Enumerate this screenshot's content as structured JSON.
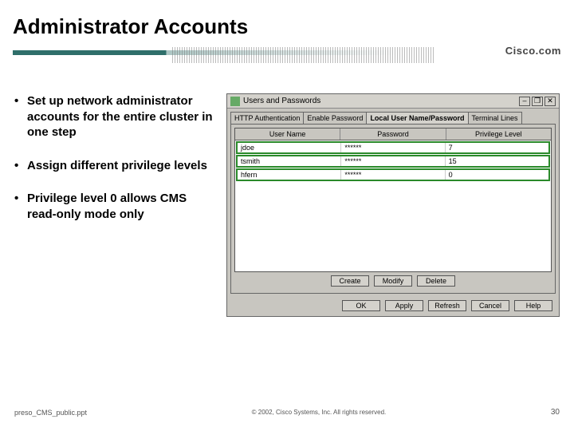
{
  "slide": {
    "title": "Administrator Accounts",
    "brand": "Cisco.com"
  },
  "bullets": [
    "Set up network administrator accounts for the entire cluster in one step",
    "Assign different privilege levels",
    "Privilege level 0 allows CMS read-only mode only"
  ],
  "dialog": {
    "title": "Users and Passwords",
    "win_minimize": "–",
    "win_maximize": "❐",
    "win_close": "✕",
    "tabs": [
      "HTTP Authentication",
      "Enable Password",
      "Local User Name/Password",
      "Terminal Lines"
    ],
    "active_tab": 2,
    "columns": [
      "User Name",
      "Password",
      "Privilege Level"
    ],
    "rows": [
      {
        "user": "jdoe",
        "password": "******",
        "level": "7"
      },
      {
        "user": "tsmith",
        "password": "******",
        "level": "15"
      },
      {
        "user": "hfern",
        "password": "******",
        "level": "0"
      }
    ],
    "panel_buttons": [
      "Create",
      "Modify",
      "Delete"
    ],
    "dialog_buttons": [
      "OK",
      "Apply",
      "Refresh",
      "Cancel",
      "Help"
    ]
  },
  "footer": {
    "left": "preso_CMS_public.ppt",
    "center": "© 2002, Cisco Systems, Inc. All rights reserved.",
    "right": "30"
  }
}
